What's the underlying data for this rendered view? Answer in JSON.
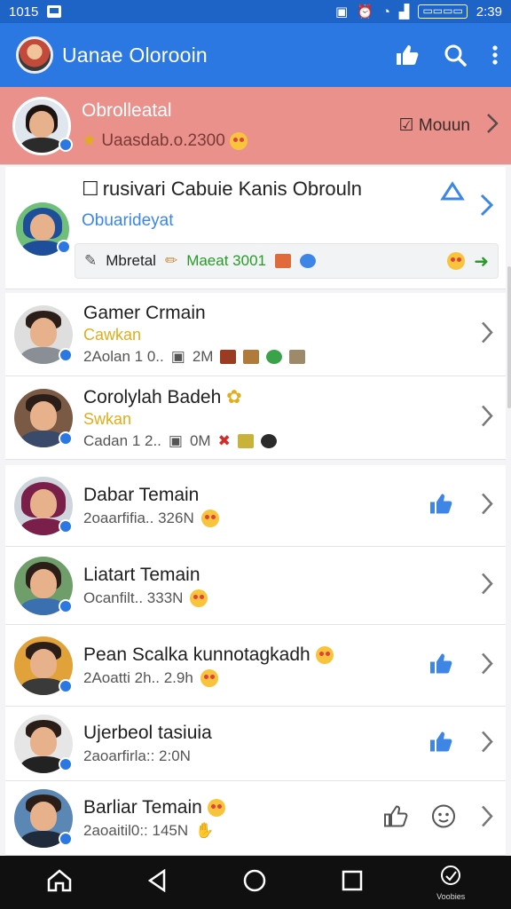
{
  "statusbar": {
    "time_left": "1015",
    "battery": "▭▭▭▭",
    "time_right": "2:39"
  },
  "appbar": {
    "title": "Uanae Olorooin"
  },
  "highlight": {
    "name": "Obrolleatal",
    "subtitle": "Uaasdab.o.2300",
    "action_label": "Mouun"
  },
  "card": {
    "title": "rusivari Cabuie Kanis Obrouln",
    "subtitle": "Obuarideyat",
    "bar_left": "Mbretal",
    "bar_green": "Maeat 3001"
  },
  "rows": [
    {
      "name": "Gamer Crmain",
      "status": "Cawkan",
      "meta": "2Aolan 1 0..",
      "size": "2M"
    },
    {
      "name": "Corolylah Badeh",
      "status": "Swkan",
      "meta": "Cadan 1 2..",
      "size": "0M"
    },
    {
      "name": "Dabar Temain",
      "status": "",
      "meta": "2oaarfifia.. 326N",
      "size": ""
    },
    {
      "name": "Liatart Temain",
      "status": "",
      "meta": "Ocanfilt.. 333N",
      "size": ""
    },
    {
      "name": "Pean Scalka kunnotagkadh",
      "status": "",
      "meta": "2Aoatti 2h.. 2.9h",
      "size": ""
    },
    {
      "name": "Ujerbeol tasiuia",
      "status": "",
      "meta": "2aoarfirla:: 2:0N",
      "size": ""
    },
    {
      "name": "Barliar Temain",
      "status": "",
      "meta": "2aoaitil0:: 145N",
      "size": ""
    }
  ],
  "navbar": {
    "assistant_label": "Voobies"
  },
  "colors": {
    "primary": "#2b78e2",
    "highlight": "#e9918a",
    "accent_yellow": "#e1ad1c",
    "link_blue": "#3d86e6"
  },
  "icons": [
    "thumb-up-icon",
    "search-icon",
    "more-vert-icon",
    "chevron-right-icon",
    "home-icon",
    "back-icon",
    "circle-home-icon",
    "recents-icon"
  ]
}
